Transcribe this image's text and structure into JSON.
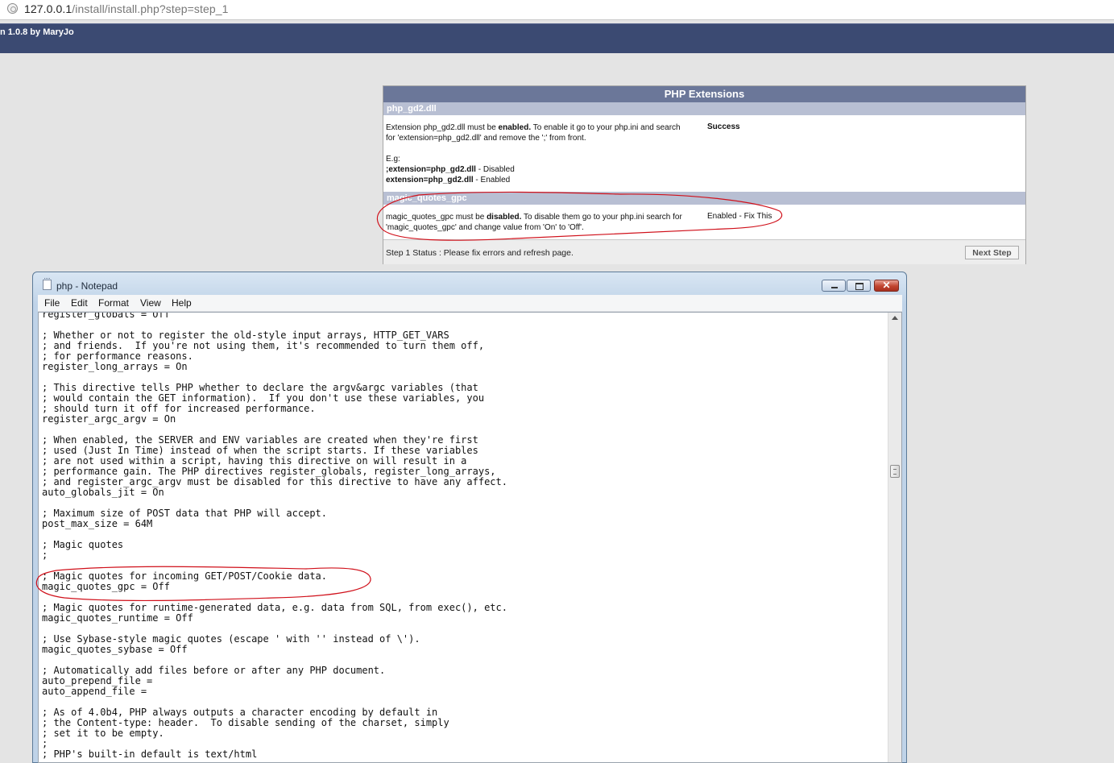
{
  "browser": {
    "url_host": "127.0.0.1",
    "url_path": "/install/install.php?step=step_1"
  },
  "site_header": {
    "title": "n 1.0.8 by MaryJo"
  },
  "installer": {
    "panel_title": "PHP Extensions",
    "sections": [
      {
        "name": "php_gd2.dll",
        "description_parts": [
          "Extension php_gd2.dll must be ",
          "enabled.",
          " To enable it go to your php.ini and search for 'extension=php_gd2.dll' and remove the ';' from front."
        ],
        "example_label": "E.g:",
        "example_disabled_code": ";extension=php_gd2.dll",
        "example_disabled_text": " - Disabled",
        "example_enabled_code": "extension=php_gd2.dll",
        "example_enabled_text": " - Enabled",
        "status": "Success"
      },
      {
        "name": "magic_quotes_gpc",
        "description_parts": [
          "magic_quotes_gpc must be ",
          "disabled.",
          " To disable them go to your php.ini search for 'magic_quotes_gpc' and change value from 'On' to 'Off'."
        ],
        "status": "Enabled - Fix This"
      }
    ],
    "step_status": "Step 1 Status : Please fix errors and refresh page.",
    "next_button": "Next Step"
  },
  "notepad": {
    "window_title": "php - Notepad",
    "menu": [
      "File",
      "Edit",
      "Format",
      "View",
      "Help"
    ],
    "content_lines": [
      "register_globals = Off",
      "",
      "; Whether or not to register the old-style input arrays, HTTP_GET_VARS",
      "; and friends.  If you're not using them, it's recommended to turn them off,",
      "; for performance reasons.",
      "register_long_arrays = On",
      "",
      "; This directive tells PHP whether to declare the argv&argc variables (that",
      "; would contain the GET information).  If you don't use these variables, you",
      "; should turn it off for increased performance.",
      "register_argc_argv = On",
      "",
      "; When enabled, the SERVER and ENV variables are created when they're first",
      "; used (Just In Time) instead of when the script starts. If these variables",
      "; are not used within a script, having this directive on will result in a",
      "; performance gain. The PHP directives register_globals, register_long_arrays,",
      "; and register_argc_argv must be disabled for this directive to have any affect.",
      "auto_globals_jit = On",
      "",
      "; Maximum size of POST data that PHP will accept.",
      "post_max_size = 64M",
      "",
      "; Magic quotes",
      ";",
      "",
      "; Magic quotes for incoming GET/POST/Cookie data.",
      "magic_quotes_gpc = Off",
      "",
      "; Magic quotes for runtime-generated data, e.g. data from SQL, from exec(), etc.",
      "magic_quotes_runtime = Off",
      "",
      "; Use Sybase-style magic quotes (escape ' with '' instead of \\').",
      "magic_quotes_sybase = Off",
      "",
      "; Automatically add files before or after any PHP document.",
      "auto_prepend_file =",
      "auto_append_file =",
      "",
      "; As of 4.0b4, PHP always outputs a character encoding by default in",
      "; the Content-type: header.  To disable sending of the charset, simply",
      "; set it to be empty.",
      ";",
      "; PHP's built-in default is text/html"
    ]
  },
  "colors": {
    "header_bg": "#3b4a72",
    "panel_head_bg": "#6b7799",
    "section_bg": "#b8bfd3",
    "annotation_red": "#d0101a"
  }
}
